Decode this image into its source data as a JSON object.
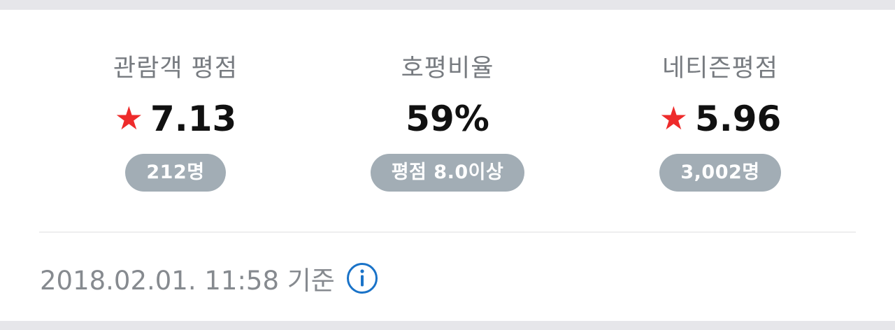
{
  "ratings": [
    {
      "label": "관람객 평점",
      "value": "7.13",
      "has_star": true,
      "badge": "212명"
    },
    {
      "label": "호평비율",
      "value": "59%",
      "has_star": false,
      "badge": "평점 8.0이상"
    },
    {
      "label": "네티즌평점",
      "value": "5.96",
      "has_star": true,
      "badge": "3,002명"
    }
  ],
  "footer": {
    "timestamp": "2018.02.01. 11:58 기준"
  },
  "icons": {
    "star": "star-icon",
    "info": "info-icon"
  },
  "colors": {
    "star": "#ee2b2b",
    "badge_bg": "#a2adb5",
    "info_icon": "#1a73c8",
    "label_text": "#777b80"
  }
}
